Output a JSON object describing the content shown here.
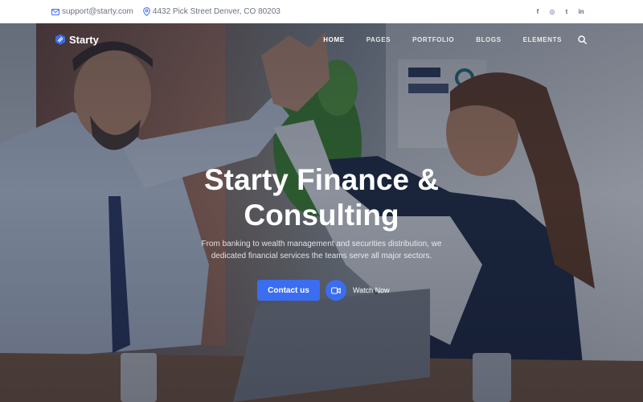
{
  "topbar": {
    "email": "support@starty.com",
    "address": "4432 Pick Street Denver, CO 80203",
    "social": [
      {
        "icon": "facebook-icon",
        "glyph": "f"
      },
      {
        "icon": "instagram-icon",
        "glyph": "◎"
      },
      {
        "icon": "twitter-icon",
        "glyph": "t"
      },
      {
        "icon": "linkedin-icon",
        "glyph": "in"
      }
    ]
  },
  "nav": {
    "logo": "Starty",
    "items": [
      "HOME",
      "PAGES",
      "PORTFOLIO",
      "BLOGS",
      "ELEMENTS"
    ],
    "active": "HOME"
  },
  "hero": {
    "title_line1": "Starty Finance &",
    "title_line2": "Consulting",
    "subtitle_line1": "From banking to wealth management and securities distribution, we",
    "subtitle_line2": "dedicated financial services the teams serve all major sectors.",
    "cta_label": "Contact us",
    "watch_label": "Watch Now"
  },
  "colors": {
    "accent": "#3a6df0",
    "topbar_bg": "#ffffff",
    "icon_blue": "#3a6df0"
  }
}
